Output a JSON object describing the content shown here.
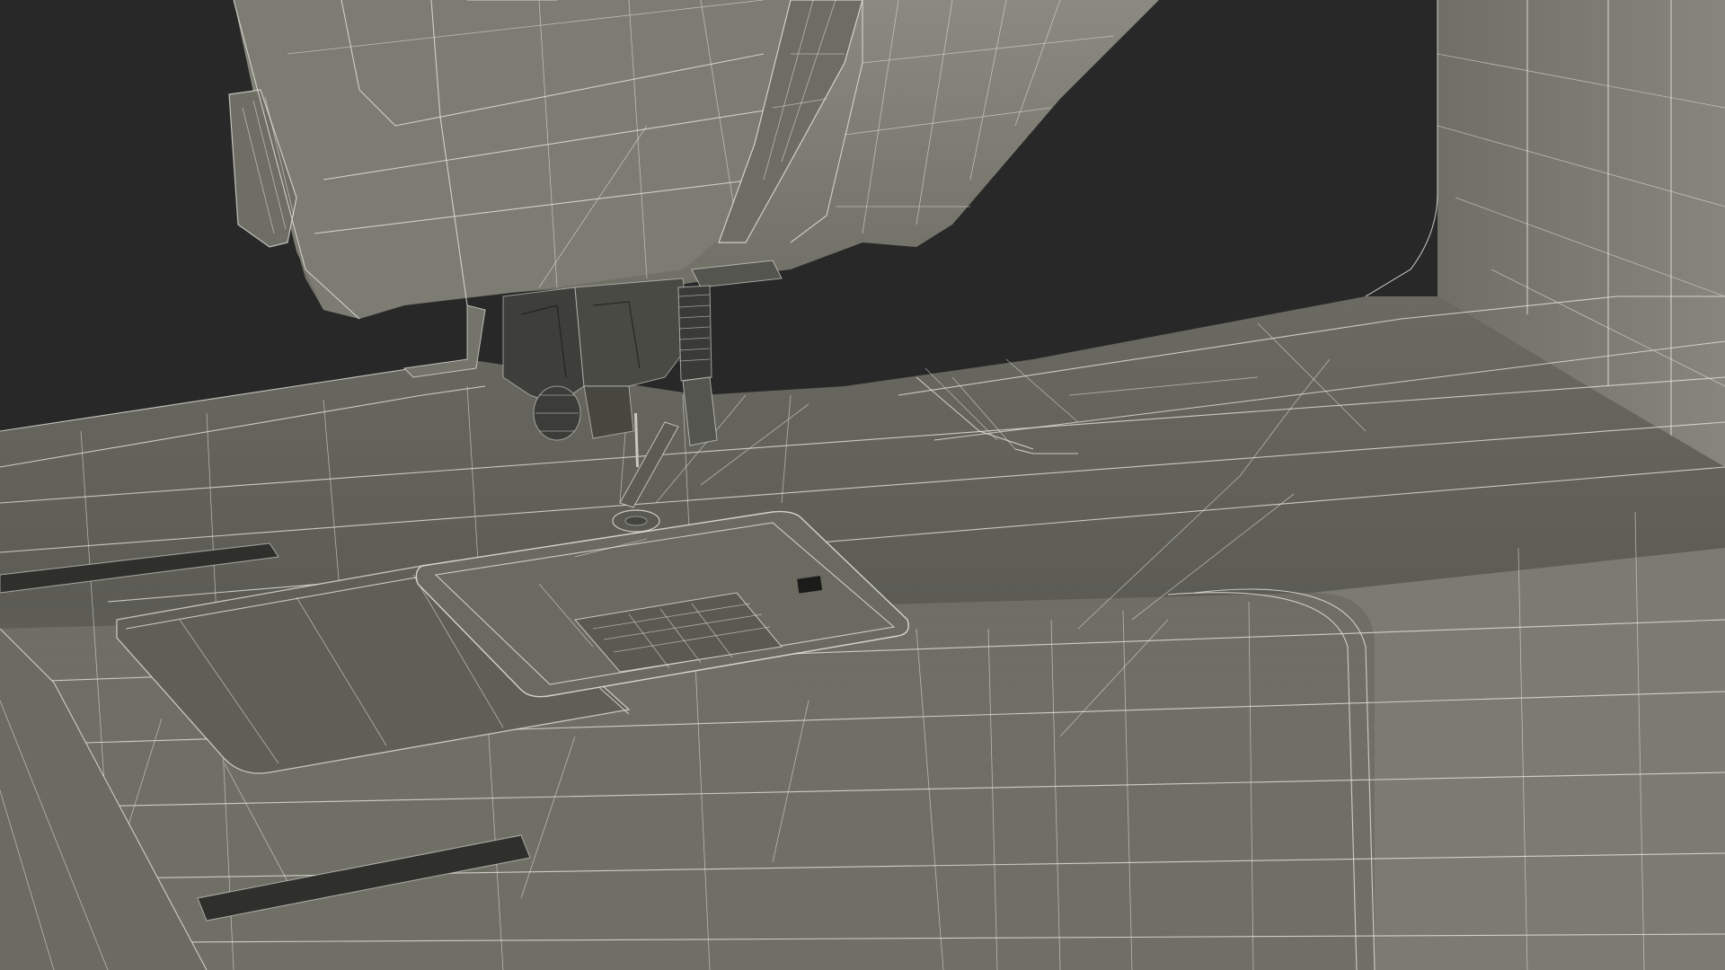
{
  "scene": {
    "subject": "sewing-machine-wireframe",
    "colors": {
      "background": "#282828",
      "surface_light": "#7a7a70",
      "surface_mid": "#67675e",
      "surface_dark": "#4f4f48",
      "wire": "#e8e8e2",
      "mechanism": "#3a3a36"
    }
  }
}
